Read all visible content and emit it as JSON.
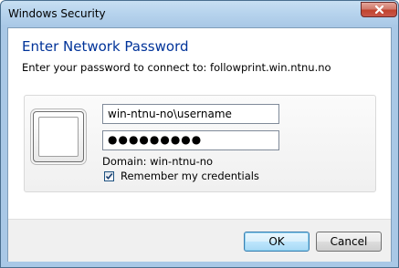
{
  "window": {
    "title": "Windows Security",
    "close_icon": "close-icon"
  },
  "dialog": {
    "heading": "Enter Network Password",
    "subheading": "Enter your password to connect to: followprint.win.ntnu.no"
  },
  "credentials": {
    "tile_icon": "user-tile-icon",
    "username_value": "win-ntnu-no\\username",
    "password_mask": "●●●●●●●●●",
    "domain_text": "Domain: win-ntnu-no",
    "remember_label": "Remember my credentials",
    "remember_checked": true
  },
  "buttons": {
    "ok_label": "OK",
    "cancel_label": "Cancel"
  },
  "colors": {
    "heading": "#003399",
    "frame": "#a9c8e6",
    "close_button": "#c1432e"
  }
}
